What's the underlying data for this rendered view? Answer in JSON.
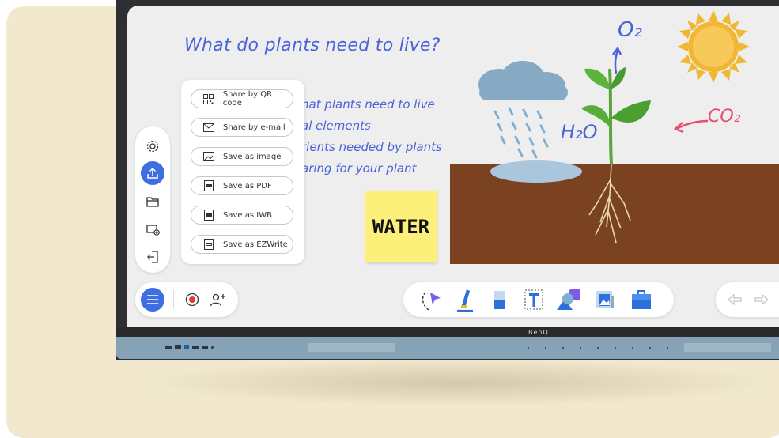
{
  "lesson": {
    "title": "What do plants need to live?",
    "lines": [
      "hat plants need to live",
      "al elements",
      "rients needed by plants",
      "aring for your plant"
    ],
    "sticky_note": "WATER",
    "diagram_labels": {
      "o2": "O₂",
      "h2o": "H₂O",
      "co2": "CO₂"
    }
  },
  "share_menu": {
    "items": [
      {
        "label": "Share by QR code",
        "icon": "qr-code-icon"
      },
      {
        "label": "Share by e-mail",
        "icon": "mail-icon"
      },
      {
        "label": "Save as image",
        "icon": "image-icon"
      },
      {
        "label": "Save as PDF",
        "icon": "pdf-icon"
      },
      {
        "label": "Save as IWB",
        "icon": "iwb-icon"
      },
      {
        "label": "Save as EZWrite",
        "icon": "ezwrite-icon"
      }
    ]
  },
  "side_tools": [
    "gear-icon",
    "export-icon",
    "folder-icon",
    "add-screen-icon",
    "exit-icon"
  ],
  "bottom_toolbar": [
    "lasso-select-icon",
    "pen-icon",
    "eraser-icon",
    "text-box-icon",
    "shapes-icon",
    "insert-image-icon",
    "toolbox-icon"
  ],
  "device": {
    "brand": "BenQ"
  },
  "colors": {
    "accent": "#3e6fe0",
    "handwriting": "#4a63d8",
    "soil": "#7a4220",
    "sticky": "#fdf07a",
    "co2": "#e94e6e"
  }
}
